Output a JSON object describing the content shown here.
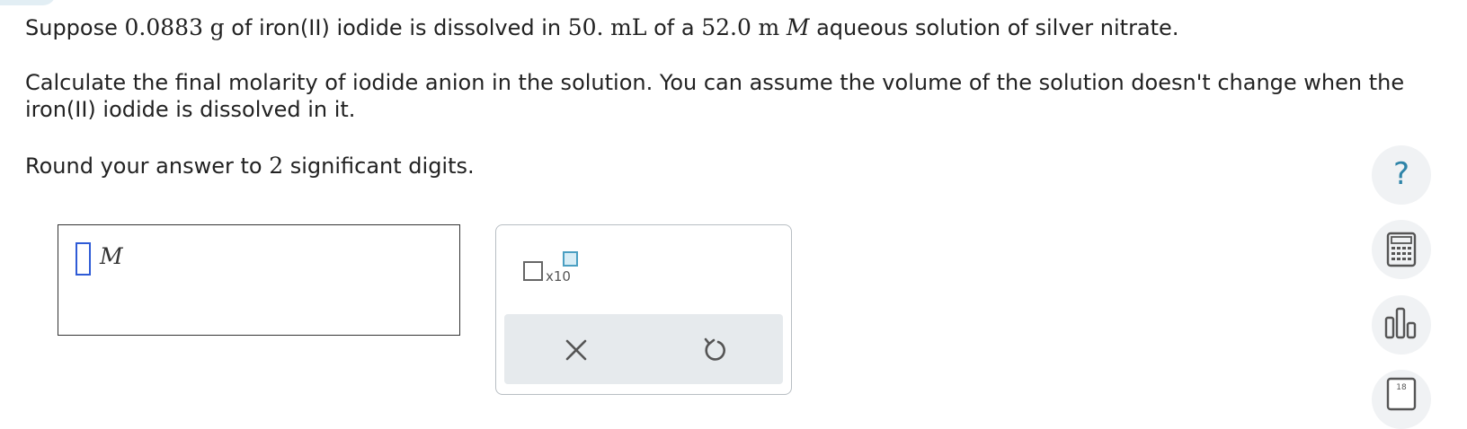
{
  "question": {
    "p1": {
      "t1": "Suppose ",
      "mass_value": "0.0883",
      "mass_unit": "g",
      "t2": " of iron(II) iodide is dissolved in ",
      "volume_value": "50.",
      "volume_unit": "mL",
      "t3": " of a ",
      "conc_value": "52.0",
      "conc_prefix": "m",
      "conc_unit": "M",
      "t4": " aqueous solution of silver nitrate."
    },
    "p2": "Calculate the final molarity of iodide anion in the solution. You can assume the volume of the solution doesn't change when the iron(II) iodide is dissolved in it.",
    "p3": {
      "t1": "Round your answer to ",
      "digits": "2",
      "t2": " significant digits."
    }
  },
  "answer": {
    "value": "",
    "unit": "M"
  },
  "tools": {
    "sci_notation_label": "x10",
    "clear_icon": "close-icon",
    "undo_icon": "undo-icon"
  },
  "side_tools": {
    "help_label": "?",
    "periodic_number": "18",
    "icons": [
      "help-icon",
      "calculator-icon",
      "bar-chart-icon",
      "periodic-table-icon"
    ]
  },
  "colors": {
    "accent": "#2e84a8",
    "cursor": "#2f5bd6",
    "action_bar": "#e6eaed",
    "side_button_bg": "#f0f2f4"
  }
}
